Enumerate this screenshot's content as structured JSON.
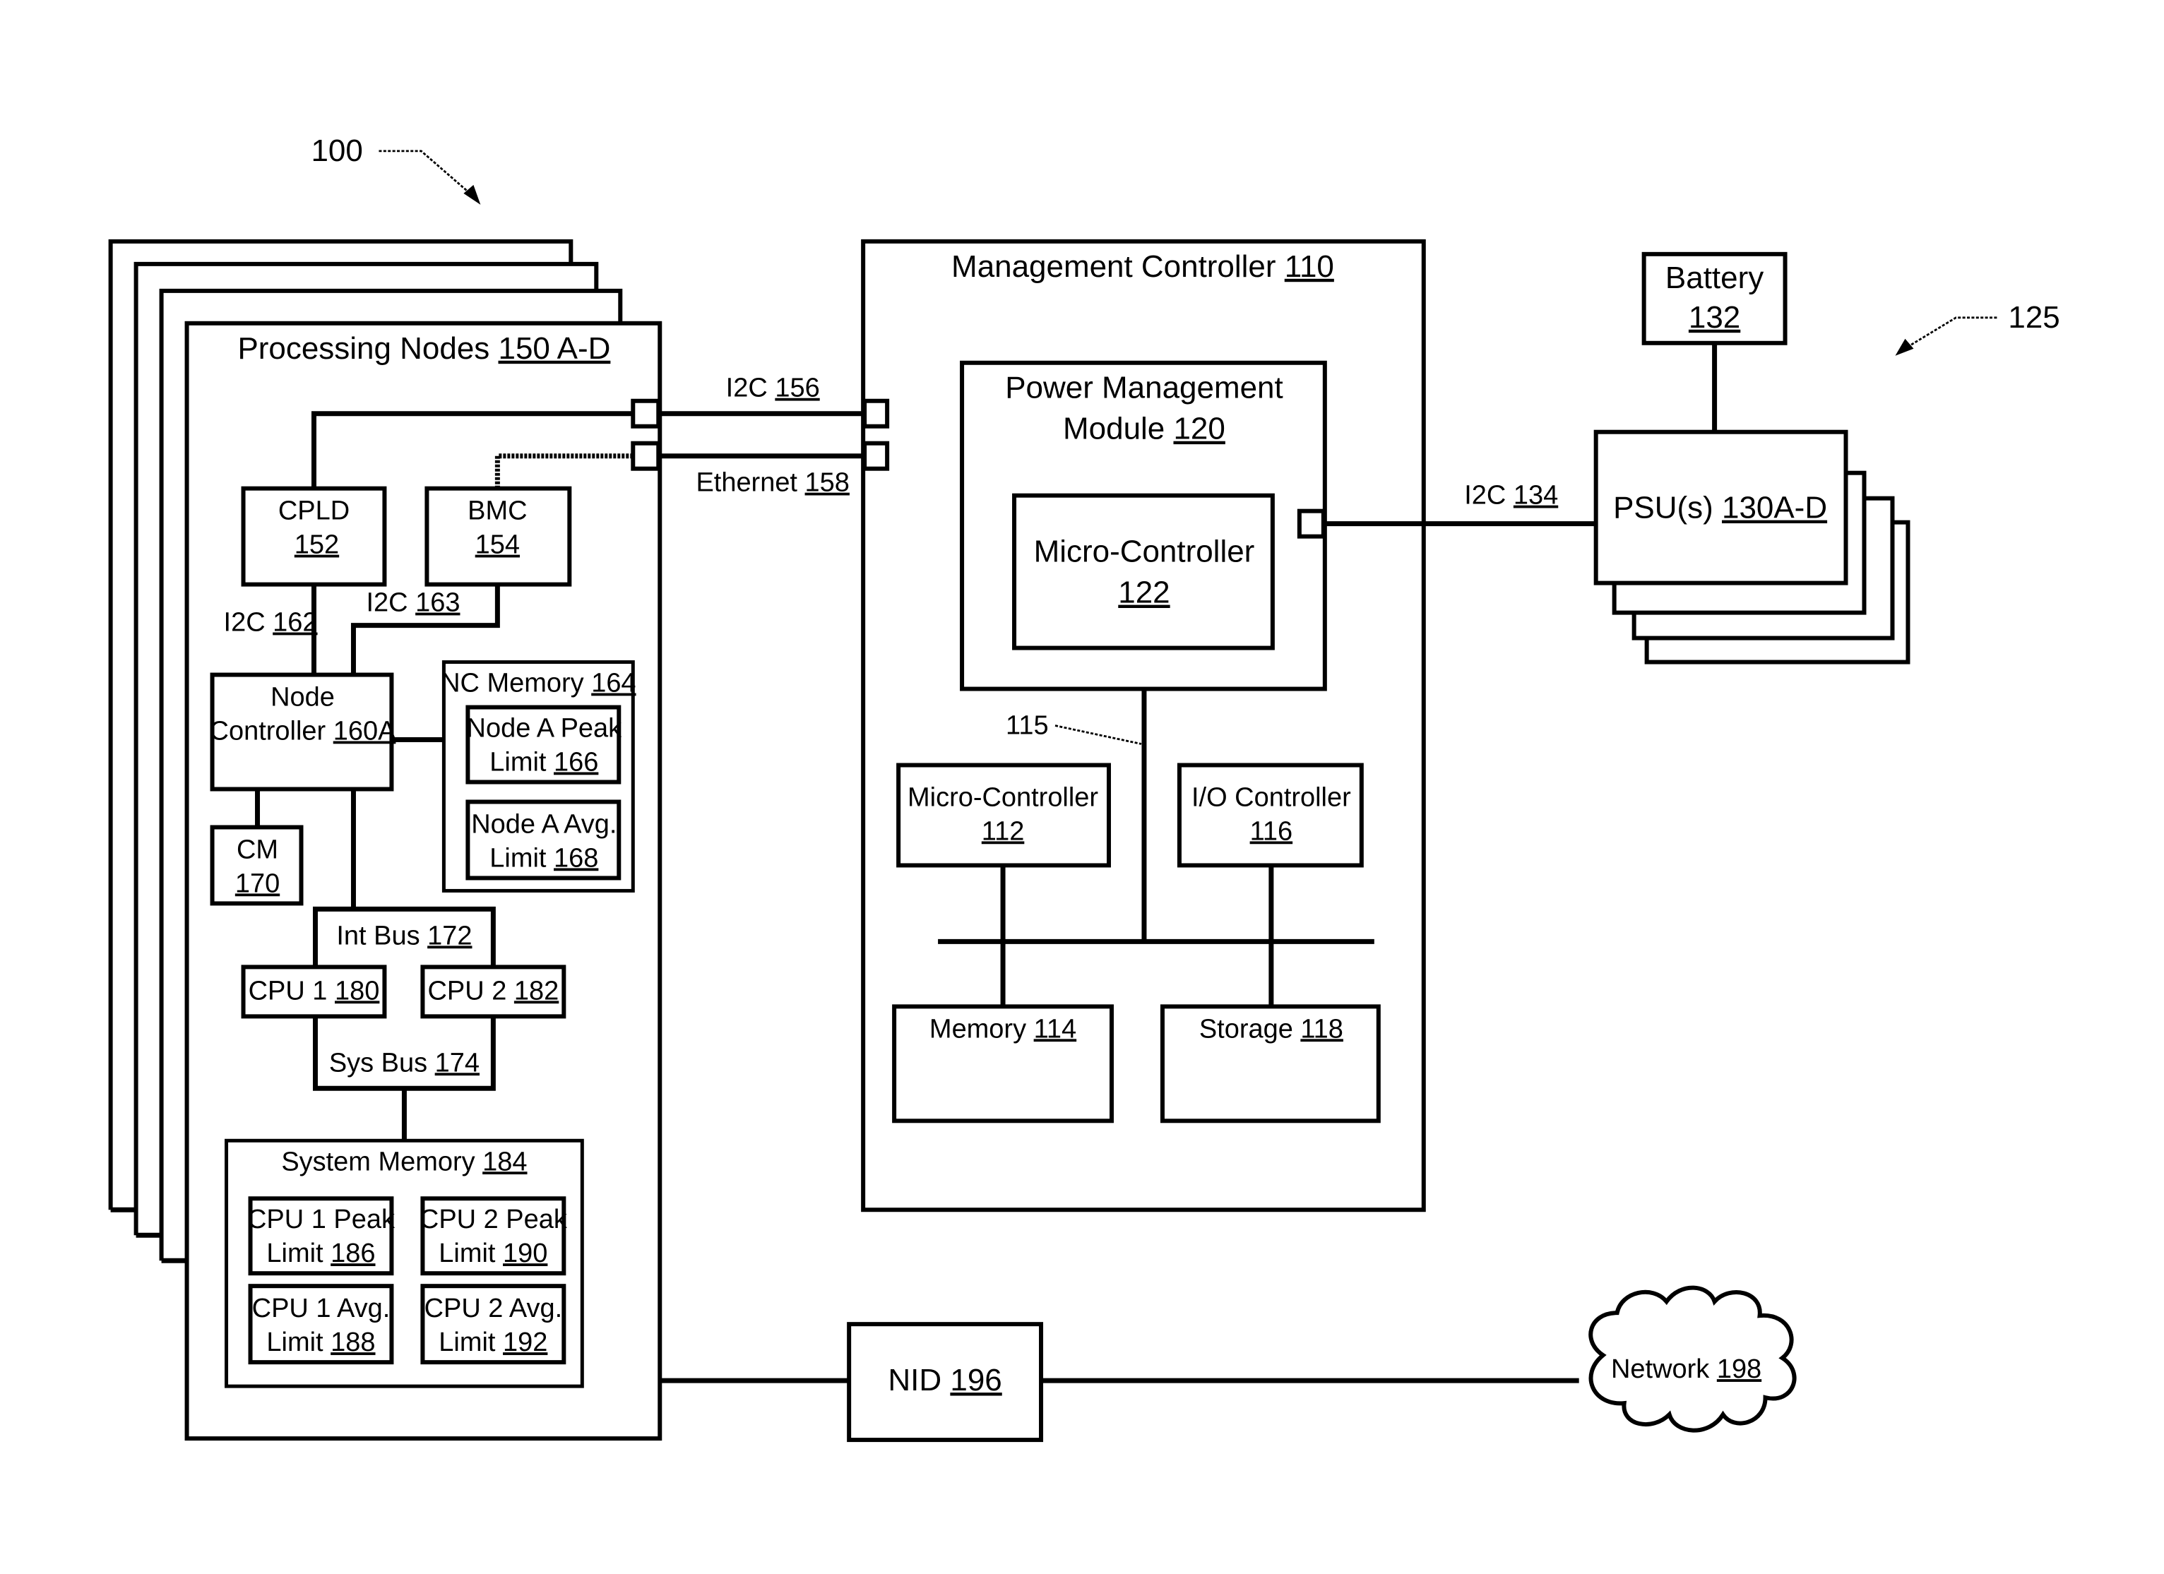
{
  "figure": {
    "ref_system": "100",
    "ref_psu_group": "125",
    "ref_internal_bus": "115"
  },
  "processing_nodes": {
    "name": "Processing Nodes",
    "num": "150 A-D",
    "cpld": {
      "name": "CPLD",
      "num": "152"
    },
    "bmc": {
      "name": "BMC",
      "num": "154"
    },
    "i2c_162": {
      "name": "I2C",
      "num": "162"
    },
    "i2c_163": {
      "name": "I2C",
      "num": "163"
    },
    "node_controller": {
      "line1": "Node",
      "line2": "Controller",
      "num": "160A"
    },
    "nc_memory": {
      "name": "NC Memory",
      "num": "164"
    },
    "node_peak_limit": {
      "line1": "Node A Peak",
      "line2": "Limit",
      "num": "166"
    },
    "node_avg_limit": {
      "line1": "Node A Avg.",
      "line2": "Limit",
      "num": "168"
    },
    "cm": {
      "name": "CM",
      "num": "170"
    },
    "int_bus": {
      "name": "Int Bus",
      "num": "172"
    },
    "cpu1": {
      "name": "CPU 1",
      "num": "180"
    },
    "cpu2": {
      "name": "CPU 2",
      "num": "182"
    },
    "sys_bus": {
      "name": "Sys Bus",
      "num": "174"
    },
    "system_memory": {
      "name": "System Memory",
      "num": "184"
    },
    "cpu1_peak": {
      "line1": "CPU 1 Peak",
      "line2": "Limit",
      "num": "186"
    },
    "cpu2_peak": {
      "line1": "CPU 2 Peak",
      "line2": "Limit",
      "num": "190"
    },
    "cpu1_avg": {
      "line1": "CPU 1 Avg.",
      "line2": "Limit",
      "num": "188"
    },
    "cpu2_avg": {
      "line1": "CPU 2 Avg.",
      "line2": "Limit",
      "num": "192"
    }
  },
  "links": {
    "i2c_156": {
      "name": "I2C",
      "num": "156"
    },
    "ethernet_158": {
      "name": "Ethernet",
      "num": "158"
    },
    "i2c_134": {
      "name": "I2C",
      "num": "134"
    }
  },
  "management_controller": {
    "name": "Management Controller",
    "num": "110",
    "pmm": {
      "line1": "Power Management",
      "line2": "Module",
      "num": "120"
    },
    "pmm_mcu": {
      "name": "Micro-Controller",
      "num": "122"
    },
    "mcu": {
      "name": "Micro-Controller",
      "num": "112"
    },
    "io_controller": {
      "name": "I/O Controller",
      "num": "116"
    },
    "memory": {
      "name": "Memory",
      "num": "114"
    },
    "storage": {
      "name": "Storage",
      "num": "118"
    }
  },
  "power": {
    "battery": {
      "name": "Battery",
      "num": "132"
    },
    "psu": {
      "name": "PSU(s)",
      "num": "130A-D"
    }
  },
  "nid": {
    "name": "NID",
    "num": "196"
  },
  "network": {
    "name": "Network",
    "num": "198"
  }
}
